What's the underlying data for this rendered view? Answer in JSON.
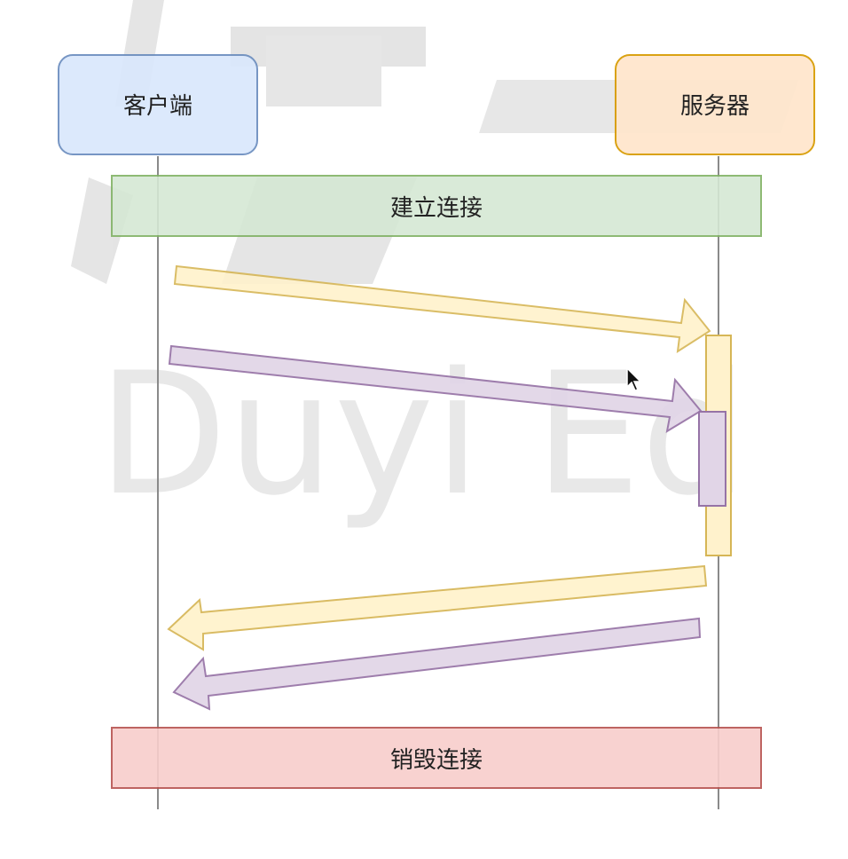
{
  "participants": {
    "client": "客户端",
    "server": "服务器"
  },
  "phases": {
    "connect": "建立连接",
    "disconnect": "销毁连接"
  },
  "watermark": {
    "text": "Duyi Ed",
    "logo_glyph": "渡一"
  },
  "messages": [
    {
      "from": "client",
      "to": "server",
      "color": "yellow"
    },
    {
      "from": "client",
      "to": "server",
      "color": "purple"
    },
    {
      "from": "server",
      "to": "client",
      "color": "yellow"
    },
    {
      "from": "server",
      "to": "client",
      "color": "purple"
    }
  ],
  "colors": {
    "client_fill": "#dae8fc",
    "client_stroke": "#6c8ebf",
    "server_fill": "#ffe6cc",
    "server_stroke": "#d79b00",
    "connect_fill": "#d5e8d4",
    "connect_stroke": "#82b366",
    "disconnect_fill": "#f8cecc",
    "disconnect_stroke": "#b85450",
    "yellow_fill": "#fff2cc",
    "yellow_stroke": "#d6b656",
    "purple_fill": "#e1d5e7",
    "purple_stroke": "#9673a6"
  }
}
